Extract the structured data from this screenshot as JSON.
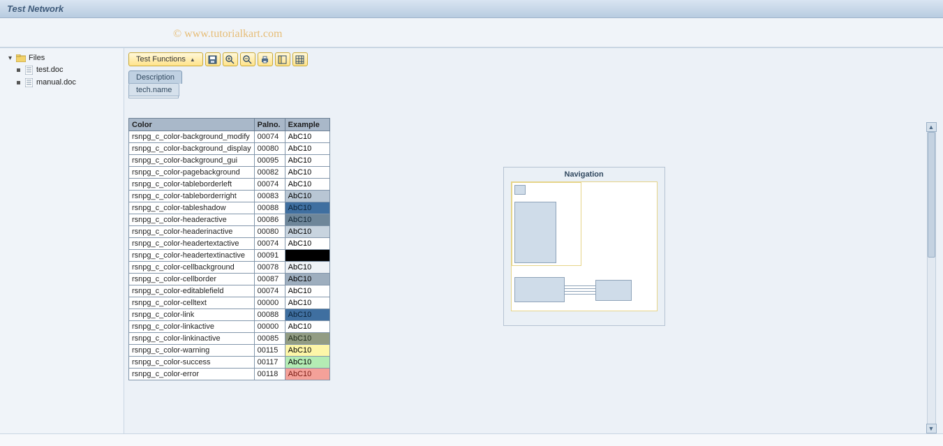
{
  "title": "Test Network",
  "watermark": "© www.tutorialkart.com",
  "tree": {
    "root_label": "Files",
    "items": [
      {
        "label": "test.doc"
      },
      {
        "label": "manual.doc"
      }
    ]
  },
  "toolbar": {
    "test_functions_label": "Test Functions",
    "icons": [
      "save-icon",
      "zoom-in-icon",
      "zoom-out-icon",
      "print-icon",
      "layout-icon",
      "grid-icon"
    ]
  },
  "tabs": {
    "description_label": "Description",
    "techname_label": "tech.name"
  },
  "table": {
    "headers": {
      "color": "Color",
      "palno": "Palno.",
      "example": "Example"
    },
    "rows": [
      {
        "color": "rsnpg_c_color-background_modify",
        "palno": "00074",
        "ex": "AbC10",
        "bg": "#ffffff",
        "fg": "#000000"
      },
      {
        "color": "rsnpg_c_color-background_display",
        "palno": "00080",
        "ex": "AbC10",
        "bg": "#ffffff",
        "fg": "#000000"
      },
      {
        "color": "rsnpg_c_color-background_gui",
        "palno": "00095",
        "ex": "AbC10",
        "bg": "#ffffff",
        "fg": "#000000"
      },
      {
        "color": "rsnpg_c_color-pagebackground",
        "palno": "00082",
        "ex": "AbC10",
        "bg": "#ffffff",
        "fg": "#000000"
      },
      {
        "color": "rsnpg_c_color-tableborderleft",
        "palno": "00074",
        "ex": "AbC10",
        "bg": "#ffffff",
        "fg": "#000000"
      },
      {
        "color": "rsnpg_c_color-tableborderright",
        "palno": "00083",
        "ex": "AbC10",
        "bg": "#b8c6d4",
        "fg": "#000000"
      },
      {
        "color": "rsnpg_c_color-tableshadow",
        "palno": "00088",
        "ex": "AbC10",
        "bg": "#3f6fa0",
        "fg": "#0a2238"
      },
      {
        "color": "rsnpg_c_color-headeractive",
        "palno": "00086",
        "ex": "AbC10",
        "bg": "#6e8699",
        "fg": "#0f2433"
      },
      {
        "color": "rsnpg_c_color-headerinactive",
        "palno": "00080",
        "ex": "AbC10",
        "bg": "#c8d4df",
        "fg": "#000000"
      },
      {
        "color": "rsnpg_c_color-headertextactive",
        "palno": "00074",
        "ex": "AbC10",
        "bg": "#ffffff",
        "fg": "#000000"
      },
      {
        "color": "rsnpg_c_color-headertextinactive",
        "palno": "00091",
        "ex": "",
        "bg": "#000000",
        "fg": "#000000"
      },
      {
        "color": "rsnpg_c_color-cellbackground",
        "palno": "00078",
        "ex": "AbC10",
        "bg": "#eef2f6",
        "fg": "#000000"
      },
      {
        "color": "rsnpg_c_color-cellborder",
        "palno": "00087",
        "ex": "AbC10",
        "bg": "#9eaebe",
        "fg": "#000000"
      },
      {
        "color": "rsnpg_c_color-editablefield",
        "palno": "00074",
        "ex": "AbC10",
        "bg": "#ffffff",
        "fg": "#000000"
      },
      {
        "color": "rsnpg_c_color-celltext",
        "palno": "00000",
        "ex": "AbC10",
        "bg": "#ffffff",
        "fg": "#000000"
      },
      {
        "color": "rsnpg_c_color-link",
        "palno": "00088",
        "ex": "AbC10",
        "bg": "#3f6fa0",
        "fg": "#0a2238"
      },
      {
        "color": "rsnpg_c_color-linkactive",
        "palno": "00000",
        "ex": "AbC10",
        "bg": "#ffffff",
        "fg": "#000000"
      },
      {
        "color": "rsnpg_c_color-linkinactive",
        "palno": "00085",
        "ex": "AbC10",
        "bg": "#929c83",
        "fg": "#1f2a18"
      },
      {
        "color": "rsnpg_c_color-warning",
        "palno": "00115",
        "ex": "AbC10",
        "bg": "#fdf6a8",
        "fg": "#000000"
      },
      {
        "color": "rsnpg_c_color-success",
        "palno": "00117",
        "ex": "AbC10",
        "bg": "#b4ecb4",
        "fg": "#000000"
      },
      {
        "color": "rsnpg_c_color-error",
        "palno": "00118",
        "ex": "AbC10",
        "bg": "#f4a199",
        "fg": "#7a1b13"
      }
    ]
  },
  "navigation": {
    "title": "Navigation"
  },
  "status": {
    "left": "",
    "right": ""
  }
}
